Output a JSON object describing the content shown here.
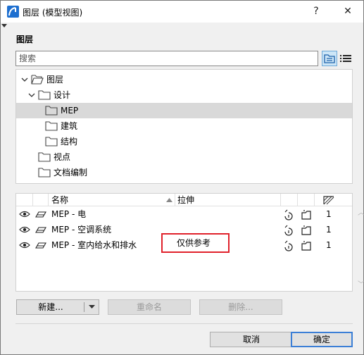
{
  "window": {
    "title": "图层 (模型视图)",
    "help_label": "?",
    "close_label": "✕"
  },
  "section_title": "图层",
  "search": {
    "placeholder": "搜索",
    "value": "搜索"
  },
  "tree": {
    "items": [
      {
        "label": "图层",
        "level": 0,
        "expanded": true,
        "selected": false
      },
      {
        "label": "设计",
        "level": 1,
        "expanded": true,
        "selected": false
      },
      {
        "label": "MEP",
        "level": 2,
        "expanded": false,
        "selected": true
      },
      {
        "label": "建筑",
        "level": 2,
        "expanded": false,
        "selected": false
      },
      {
        "label": "结构",
        "level": 2,
        "expanded": false,
        "selected": false
      },
      {
        "label": "视点",
        "level": 1,
        "expanded": false,
        "selected": false
      },
      {
        "label": "文档编制",
        "level": 1,
        "expanded": false,
        "selected": false
      }
    ]
  },
  "table": {
    "col_name": "名称",
    "col_ext": "拉伸",
    "rows": [
      {
        "name": "MEP - 电",
        "ext": "",
        "count": "1"
      },
      {
        "name": "MEP - 空调系统",
        "ext": "",
        "count": "1"
      },
      {
        "name": "MEP - 室内给水和排水",
        "ext": "仅供参考",
        "count": "1"
      }
    ]
  },
  "buttons": {
    "new": "新建...",
    "rename": "重命名",
    "delete": "删除...",
    "cancel": "取消",
    "ok": "确定"
  },
  "colors": {
    "accent": "#3c7fd6",
    "highlight_border": "#e0212b",
    "selected_row": "#d9d9d9"
  }
}
